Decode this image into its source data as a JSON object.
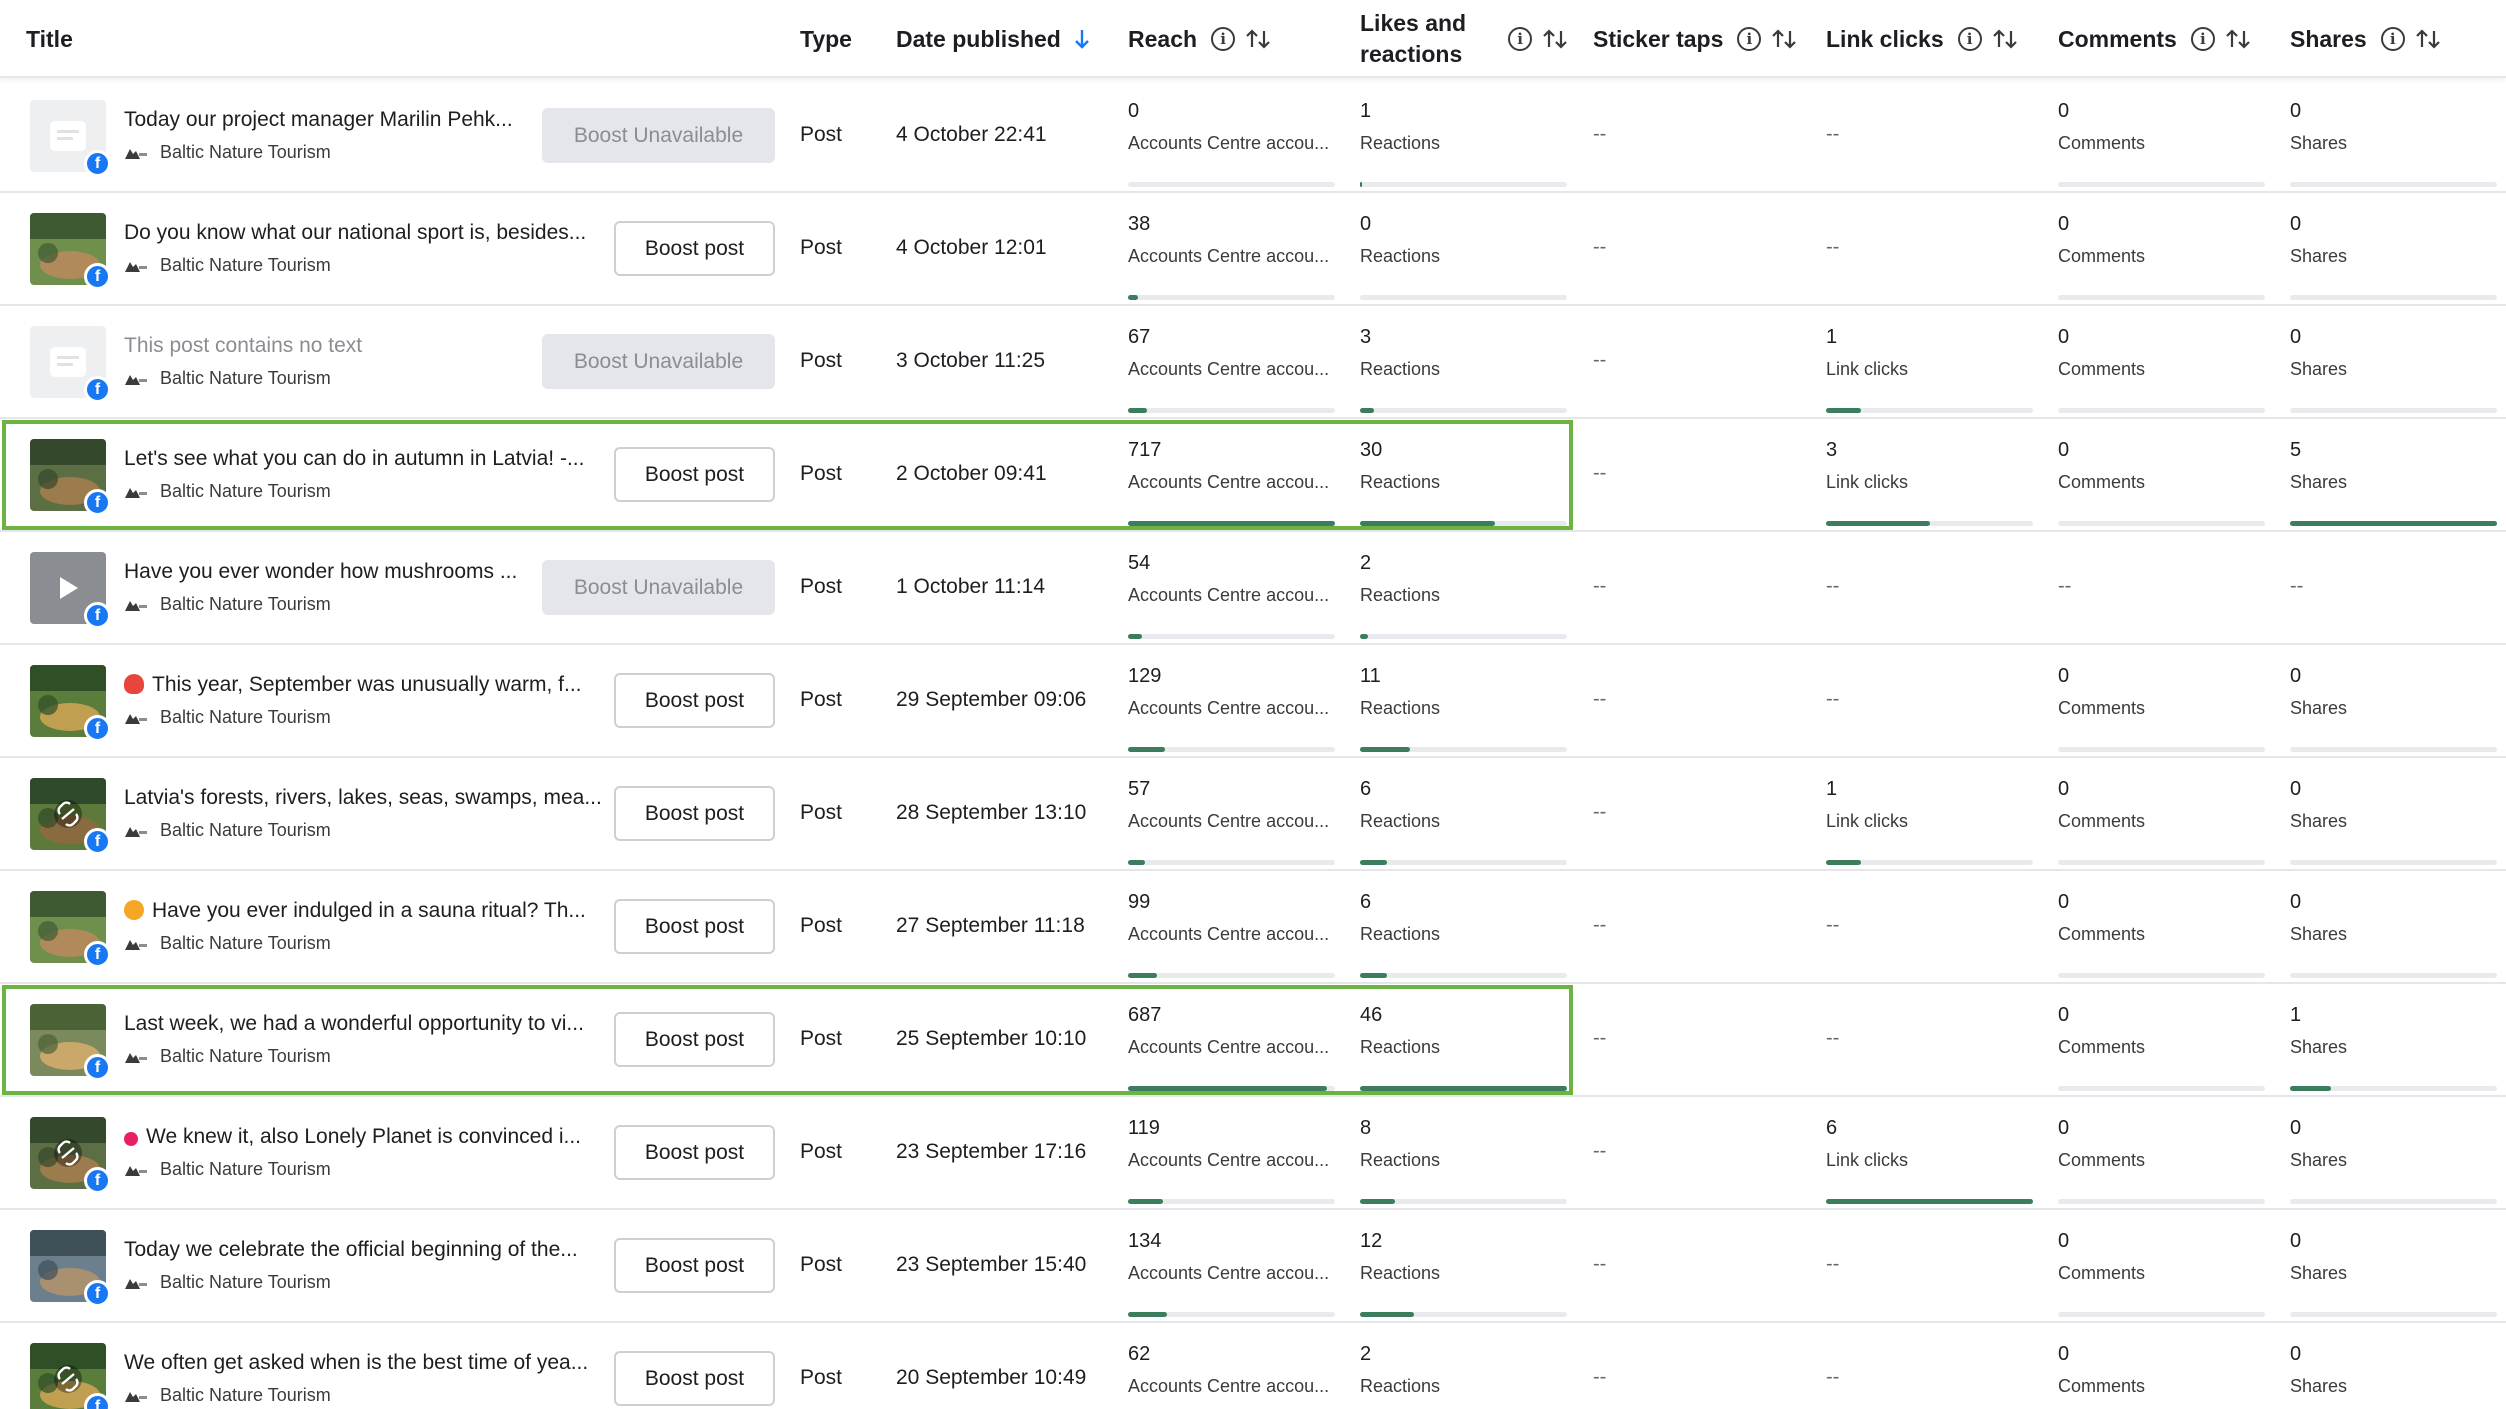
{
  "header": {
    "title": "Title",
    "type": "Type",
    "date_published": "Date published",
    "reach": "Reach",
    "likes_line1": "Likes and",
    "likes_line2": "reactions",
    "sticker_taps": "Sticker taps",
    "link_clicks": "Link clicks",
    "comments": "Comments",
    "shares": "Shares"
  },
  "page_name": "Baltic Nature Tourism",
  "labels": {
    "reach": "Accounts Centre accou...",
    "reactions": "Reactions",
    "link_clicks": "Link clicks",
    "comments": "Comments",
    "shares": "Shares",
    "empty": "--",
    "boost_unavailable": "Boost Unavailable",
    "boost_post": "Boost post",
    "type_post": "Post"
  },
  "colors": {
    "bar_fill": "#3b7d5c",
    "highlight": "#6bb343",
    "facebook": "#1877f2"
  },
  "rows": [
    {
      "text": "Today our project manager Marilin Pehk...",
      "emoji": "",
      "thumb": "placeholder",
      "boost": "unavailable",
      "date": "4 October 22:41",
      "reach": "0",
      "reach_fill": 0,
      "reactions": "1",
      "reactions_fill": 0.01,
      "sticker": "--",
      "link_clicks": "--",
      "link_fill": 0,
      "comments": "0",
      "comments_fill": 0,
      "shares": "0",
      "shares_fill": 0,
      "highlight": false
    },
    {
      "text": "Do you know what our national sport is, besides...",
      "emoji": "",
      "thumb": "photo",
      "boost": "active",
      "date": "4 October 12:01",
      "reach": "38",
      "reach_fill": 0.05,
      "reactions": "0",
      "reactions_fill": 0,
      "sticker": "--",
      "link_clicks": "--",
      "link_fill": 0,
      "comments": "0",
      "comments_fill": 0,
      "shares": "0",
      "shares_fill": 0,
      "highlight": false
    },
    {
      "text": "This post contains no text",
      "emoji": "",
      "thumb": "placeholder",
      "boost": "unavailable",
      "date": "3 October 11:25",
      "muted": true,
      "reach": "67",
      "reach_fill": 0.09,
      "reactions": "3",
      "reactions_fill": 0.07,
      "sticker": "--",
      "link_clicks": "1",
      "link_fill": 0.17,
      "comments": "0",
      "comments_fill": 0,
      "shares": "0",
      "shares_fill": 0,
      "highlight": false
    },
    {
      "text": "Let's see what you can do in autumn in Latvia! -...",
      "emoji": "",
      "thumb": "photo",
      "boost": "active",
      "date": "2 October 09:41",
      "reach": "717",
      "reach_fill": 1.0,
      "reactions": "30",
      "reactions_fill": 0.65,
      "sticker": "--",
      "link_clicks": "3",
      "link_fill": 0.5,
      "comments": "0",
      "comments_fill": 0,
      "shares": "5",
      "shares_fill": 1.0,
      "highlight": true
    },
    {
      "text": "Have you ever wonder how mushrooms ...",
      "emoji": "",
      "thumb": "video",
      "boost": "unavailable",
      "date": "1 October 11:14",
      "reach": "54",
      "reach_fill": 0.07,
      "reactions": "2",
      "reactions_fill": 0.04,
      "sticker": "--",
      "link_clicks": "--",
      "link_fill": 0,
      "comments": "--",
      "comments_fill": 0,
      "shares": "--",
      "shares_fill": 0,
      "highlight": false
    },
    {
      "text": "This year, September was unusually warm, f...",
      "emoji": "heart",
      "thumb": "photo",
      "boost": "active",
      "date": "29 September 09:06",
      "reach": "129",
      "reach_fill": 0.18,
      "reactions": "11",
      "reactions_fill": 0.24,
      "sticker": "--",
      "link_clicks": "--",
      "link_fill": 0,
      "comments": "0",
      "comments_fill": 0,
      "shares": "0",
      "shares_fill": 0,
      "highlight": false
    },
    {
      "text": "Latvia's forests, rivers, lakes, seas, swamps, mea...",
      "emoji": "",
      "thumb": "link",
      "boost": "active",
      "date": "28 September 13:10",
      "reach": "57",
      "reach_fill": 0.08,
      "reactions": "6",
      "reactions_fill": 0.13,
      "sticker": "--",
      "link_clicks": "1",
      "link_fill": 0.17,
      "comments": "0",
      "comments_fill": 0,
      "shares": "0",
      "shares_fill": 0,
      "highlight": false
    },
    {
      "text": "Have you ever indulged in a sauna ritual? Th...",
      "emoji": "sauna",
      "thumb": "photo",
      "boost": "active",
      "date": "27 September 11:18",
      "reach": "99",
      "reach_fill": 0.14,
      "reactions": "6",
      "reactions_fill": 0.13,
      "sticker": "--",
      "link_clicks": "--",
      "link_fill": 0,
      "comments": "0",
      "comments_fill": 0,
      "shares": "0",
      "shares_fill": 0,
      "highlight": false
    },
    {
      "text": "Last week, we had a wonderful opportunity to vi...",
      "emoji": "",
      "thumb": "photo",
      "boost": "active",
      "date": "25 September 10:10",
      "reach": "687",
      "reach_fill": 0.96,
      "reactions": "46",
      "reactions_fill": 1.0,
      "sticker": "--",
      "link_clicks": "--",
      "link_fill": 0,
      "comments": "0",
      "comments_fill": 0,
      "shares": "1",
      "shares_fill": 0.2,
      "highlight": true
    },
    {
      "text": "We knew it, also Lonely Planet is convinced i...",
      "emoji": "pin",
      "thumb": "link",
      "boost": "active",
      "date": "23 September 17:16",
      "reach": "119",
      "reach_fill": 0.17,
      "reactions": "8",
      "reactions_fill": 0.17,
      "sticker": "--",
      "link_clicks": "6",
      "link_fill": 1.0,
      "comments": "0",
      "comments_fill": 0,
      "shares": "0",
      "shares_fill": 0,
      "highlight": false
    },
    {
      "text": "Today we celebrate the official beginning of the...",
      "emoji": "",
      "thumb": "photo",
      "boost": "active",
      "date": "23 September 15:40",
      "reach": "134",
      "reach_fill": 0.19,
      "reactions": "12",
      "reactions_fill": 0.26,
      "sticker": "--",
      "link_clicks": "--",
      "link_fill": 0,
      "comments": "0",
      "comments_fill": 0,
      "shares": "0",
      "shares_fill": 0,
      "highlight": false
    },
    {
      "text": "We often get asked when is the best time of yea...",
      "emoji": "",
      "thumb": "link",
      "boost": "active",
      "date": "20 September 10:49",
      "reach": "62",
      "reach_fill": 0.09,
      "reactions": "2",
      "reactions_fill": 0.04,
      "sticker": "--",
      "link_clicks": "--",
      "link_fill": 0,
      "comments": "0",
      "comments_fill": 0,
      "shares": "0",
      "shares_fill": 0,
      "highlight": false
    }
  ]
}
